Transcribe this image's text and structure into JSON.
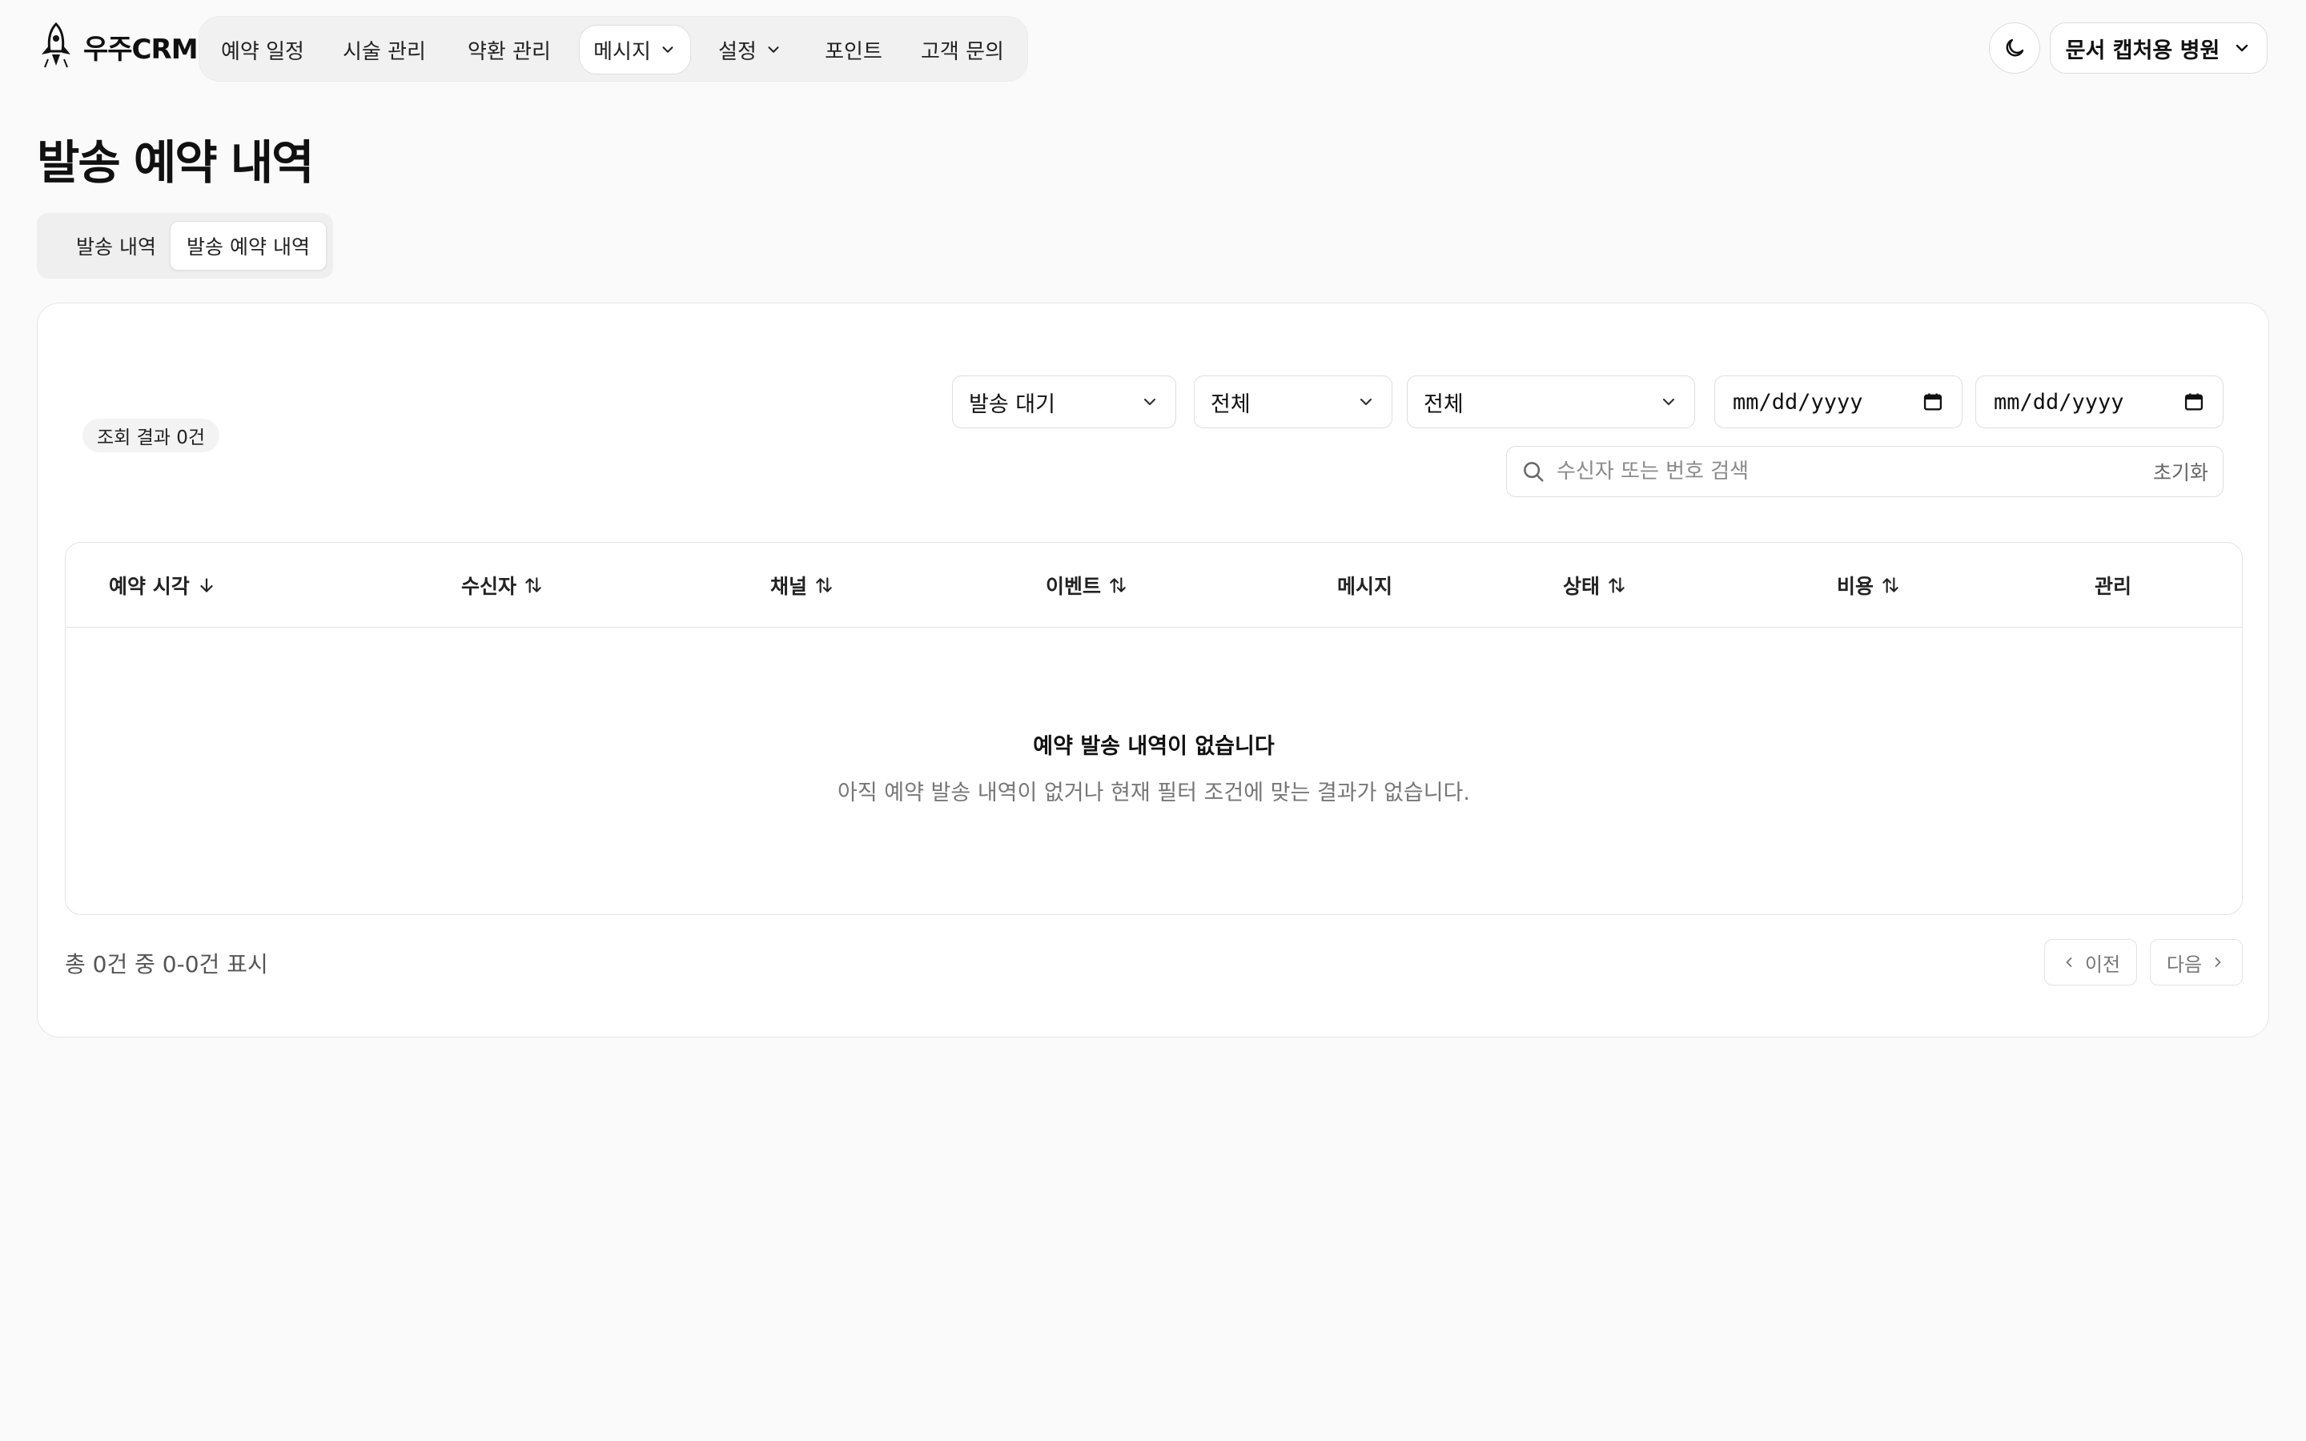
{
  "brand": {
    "name": "우주CRM"
  },
  "nav": {
    "items": [
      {
        "label": "예약 일정"
      },
      {
        "label": "시술 관리"
      },
      {
        "label": "약환 관리"
      },
      {
        "label": "메시지"
      },
      {
        "label": "설정"
      },
      {
        "label": "포인트"
      },
      {
        "label": "고객 문의"
      }
    ],
    "clinic_label": "문서 캡처용 병원"
  },
  "page": {
    "title": "발송 예약 내역",
    "tabs": [
      {
        "label": "발송 내역"
      },
      {
        "label": "발송 예약 내역"
      }
    ]
  },
  "filters": {
    "count_badge": "조회 결과 0건",
    "status_select": "발송 대기",
    "channel_select": "전체",
    "event_select": "전체",
    "date_from": "mm/dd/yyyy",
    "date_to": "mm/dd/yyyy",
    "search_placeholder": "수신자 또는 번호 검색",
    "reset_label": "초기화"
  },
  "table": {
    "columns": [
      {
        "label": "예약 시각"
      },
      {
        "label": "수신자"
      },
      {
        "label": "채널"
      },
      {
        "label": "이벤트"
      },
      {
        "label": "메시지"
      },
      {
        "label": "상태"
      },
      {
        "label": "비용"
      },
      {
        "label": "관리"
      }
    ],
    "empty_title": "예약 발송 내역이 없습니다",
    "empty_description": "아직 예약 발송 내역이 없거나 현재 필터 조건에 맞는 결과가 없습니다."
  },
  "pagination": {
    "summary": "총 0건 중 0-0건 표시",
    "prev_label": "이전",
    "next_label": "다음"
  }
}
